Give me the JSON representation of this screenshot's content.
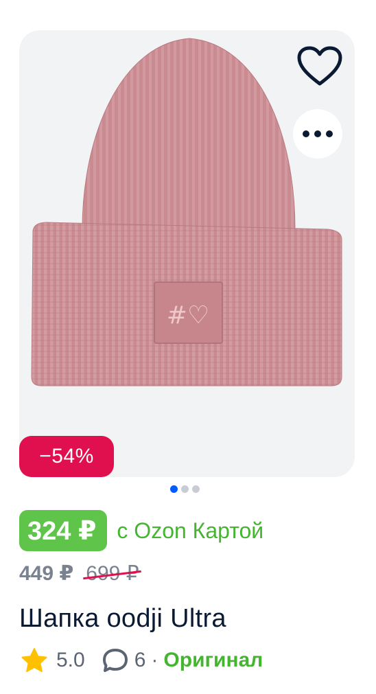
{
  "product": {
    "discount_badge": "−54%",
    "price": "324 ₽",
    "price_note": "с Ozon Картой",
    "price_without_card": "449 ₽",
    "original_price": "699 ₽",
    "title": "Шапка oodji Ultra",
    "rating": "5.0",
    "reviews_count": "6",
    "separator": "·",
    "original_label": "Оригинал"
  },
  "gallery": {
    "image_count": 3,
    "active_index": 0
  },
  "icons": {
    "favorite": "heart-outline-icon",
    "more": "more-dots-icon",
    "rating": "star-icon",
    "reviews": "speech-bubble-icon"
  },
  "colors": {
    "discount": "#e0104e",
    "price_pill": "#5ec54a",
    "card_text": "#45b531",
    "pager_active": "#005bff",
    "hat": "#c98a90"
  }
}
